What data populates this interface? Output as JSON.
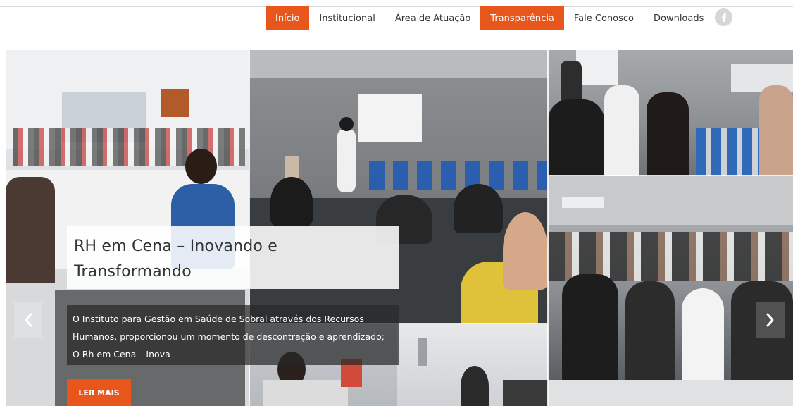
{
  "nav": {
    "items": [
      {
        "label": "Início",
        "active": true
      },
      {
        "label": "Institucional",
        "active": false
      },
      {
        "label": "Área de Atuação",
        "active": false
      },
      {
        "label": "Transparência",
        "active": true
      },
      {
        "label": "Fale Conosco",
        "active": false
      },
      {
        "label": "Downloads",
        "active": false
      }
    ],
    "social_icon": "facebook-icon"
  },
  "slider": {
    "title": "RH em Cena – Inovando e Transformando",
    "excerpt": "O Instituto para Gestão em Saúde de Sobral através dos Recursos Humanos, proporcionou um momento de descontração e aprendizado; O Rh em Cena – Inova",
    "read_more_label": "LER MAIS",
    "prev_icon": "chevron-left-icon",
    "next_icon": "chevron-right-icon"
  },
  "colors": {
    "accent": "#e8561c",
    "text": "#333333",
    "social": "#d6d6d6"
  }
}
